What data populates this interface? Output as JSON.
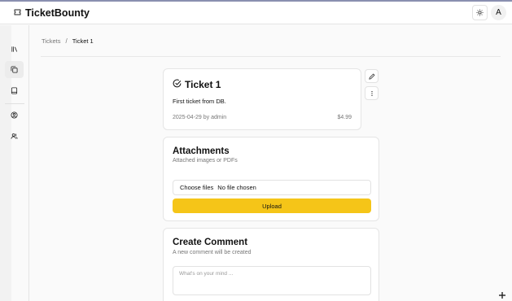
{
  "header": {
    "app_title": "TicketBounty",
    "avatar_initial": "A"
  },
  "breadcrumb": {
    "items": [
      "Tickets",
      "Ticket 1"
    ],
    "separator": "/"
  },
  "ticket": {
    "title": "Ticket 1",
    "content": "First ticket from DB.",
    "meta": "2025-04-29 by admin",
    "price": "$4.99"
  },
  "attachments": {
    "title": "Attachments",
    "description": "Attached images or PDFs",
    "choose_label": "Choose files",
    "no_file_text": "No file chosen",
    "upload_label": "Upload"
  },
  "comment": {
    "title": "Create Comment",
    "description": "A new comment will be created",
    "placeholder": "What's on your mind ..."
  },
  "colors": {
    "accent": "#f5c518",
    "muted_text": "#777777",
    "border": "#e5e5e5"
  },
  "icons": {
    "logo": "ticket-icon",
    "theme": "sun-icon",
    "nav": [
      "library-icon",
      "copy-icon",
      "book-icon",
      "user-circle-icon",
      "users-icon"
    ],
    "ticket_status": "check-circle-icon",
    "edit": "pencil-icon",
    "more": "more-vertical-icon"
  }
}
